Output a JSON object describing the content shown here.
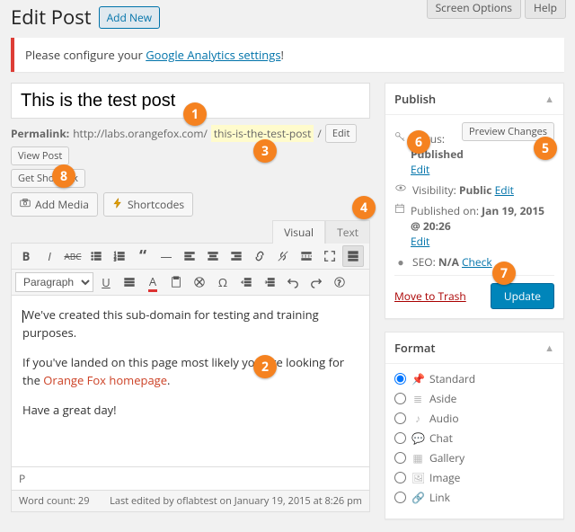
{
  "header": {
    "title": "Edit Post",
    "add_new": "Add New",
    "screen_options": "Screen Options",
    "help": "Help"
  },
  "notice": {
    "prefix": "Please configure your ",
    "link": "Google Analytics settings",
    "suffix": "!"
  },
  "post": {
    "title": "This is the test post",
    "permalink_label": "Permalink:",
    "permalink_base": "http://labs.orangefox.com/",
    "permalink_slug": "this-is-the-test-post",
    "permalink_tail": "/",
    "edit_btn": "Edit",
    "view_btn": "View Post",
    "shortlink_btn": "Get Shortlink",
    "add_media": "Add Media",
    "shortcodes": "Shortcodes",
    "tab_visual": "Visual",
    "tab_text": "Text",
    "paragraph": "Paragraph",
    "body_p1": "We've created this sub-domain for testing and training purposes.",
    "body_p2a": "If you've landed on this page most likely you are looking for the ",
    "body_p2_link": "Orange Fox homepage",
    "body_p2b": ".",
    "body_p3": "Have a great day!",
    "path": "P",
    "wordcount_label": "Word count: ",
    "wordcount": "29",
    "last_edited": "Last edited by oflabtest on January 19, 2015 at 8:26 pm"
  },
  "publish": {
    "heading": "Publish",
    "preview": "Preview Changes",
    "status_label": "Status:",
    "status_value": "Published",
    "visibility_label": "Visibility:",
    "visibility_value": "Public",
    "date_label": "Published on:",
    "date_value": "Jan 19, 2015 @ 20:26",
    "seo_label": "SEO:",
    "seo_value": "N/A",
    "seo_link": "Check",
    "edit_link": "Edit",
    "trash": "Move to Trash",
    "update": "Update"
  },
  "format": {
    "heading": "Format",
    "items": [
      {
        "label": "Standard",
        "checked": true
      },
      {
        "label": "Aside",
        "checked": false
      },
      {
        "label": "Audio",
        "checked": false
      },
      {
        "label": "Chat",
        "checked": false
      },
      {
        "label": "Gallery",
        "checked": false
      },
      {
        "label": "Image",
        "checked": false
      },
      {
        "label": "Link",
        "checked": false
      }
    ]
  },
  "badges": [
    "1",
    "2",
    "3",
    "4",
    "5",
    "6",
    "7",
    "8"
  ]
}
